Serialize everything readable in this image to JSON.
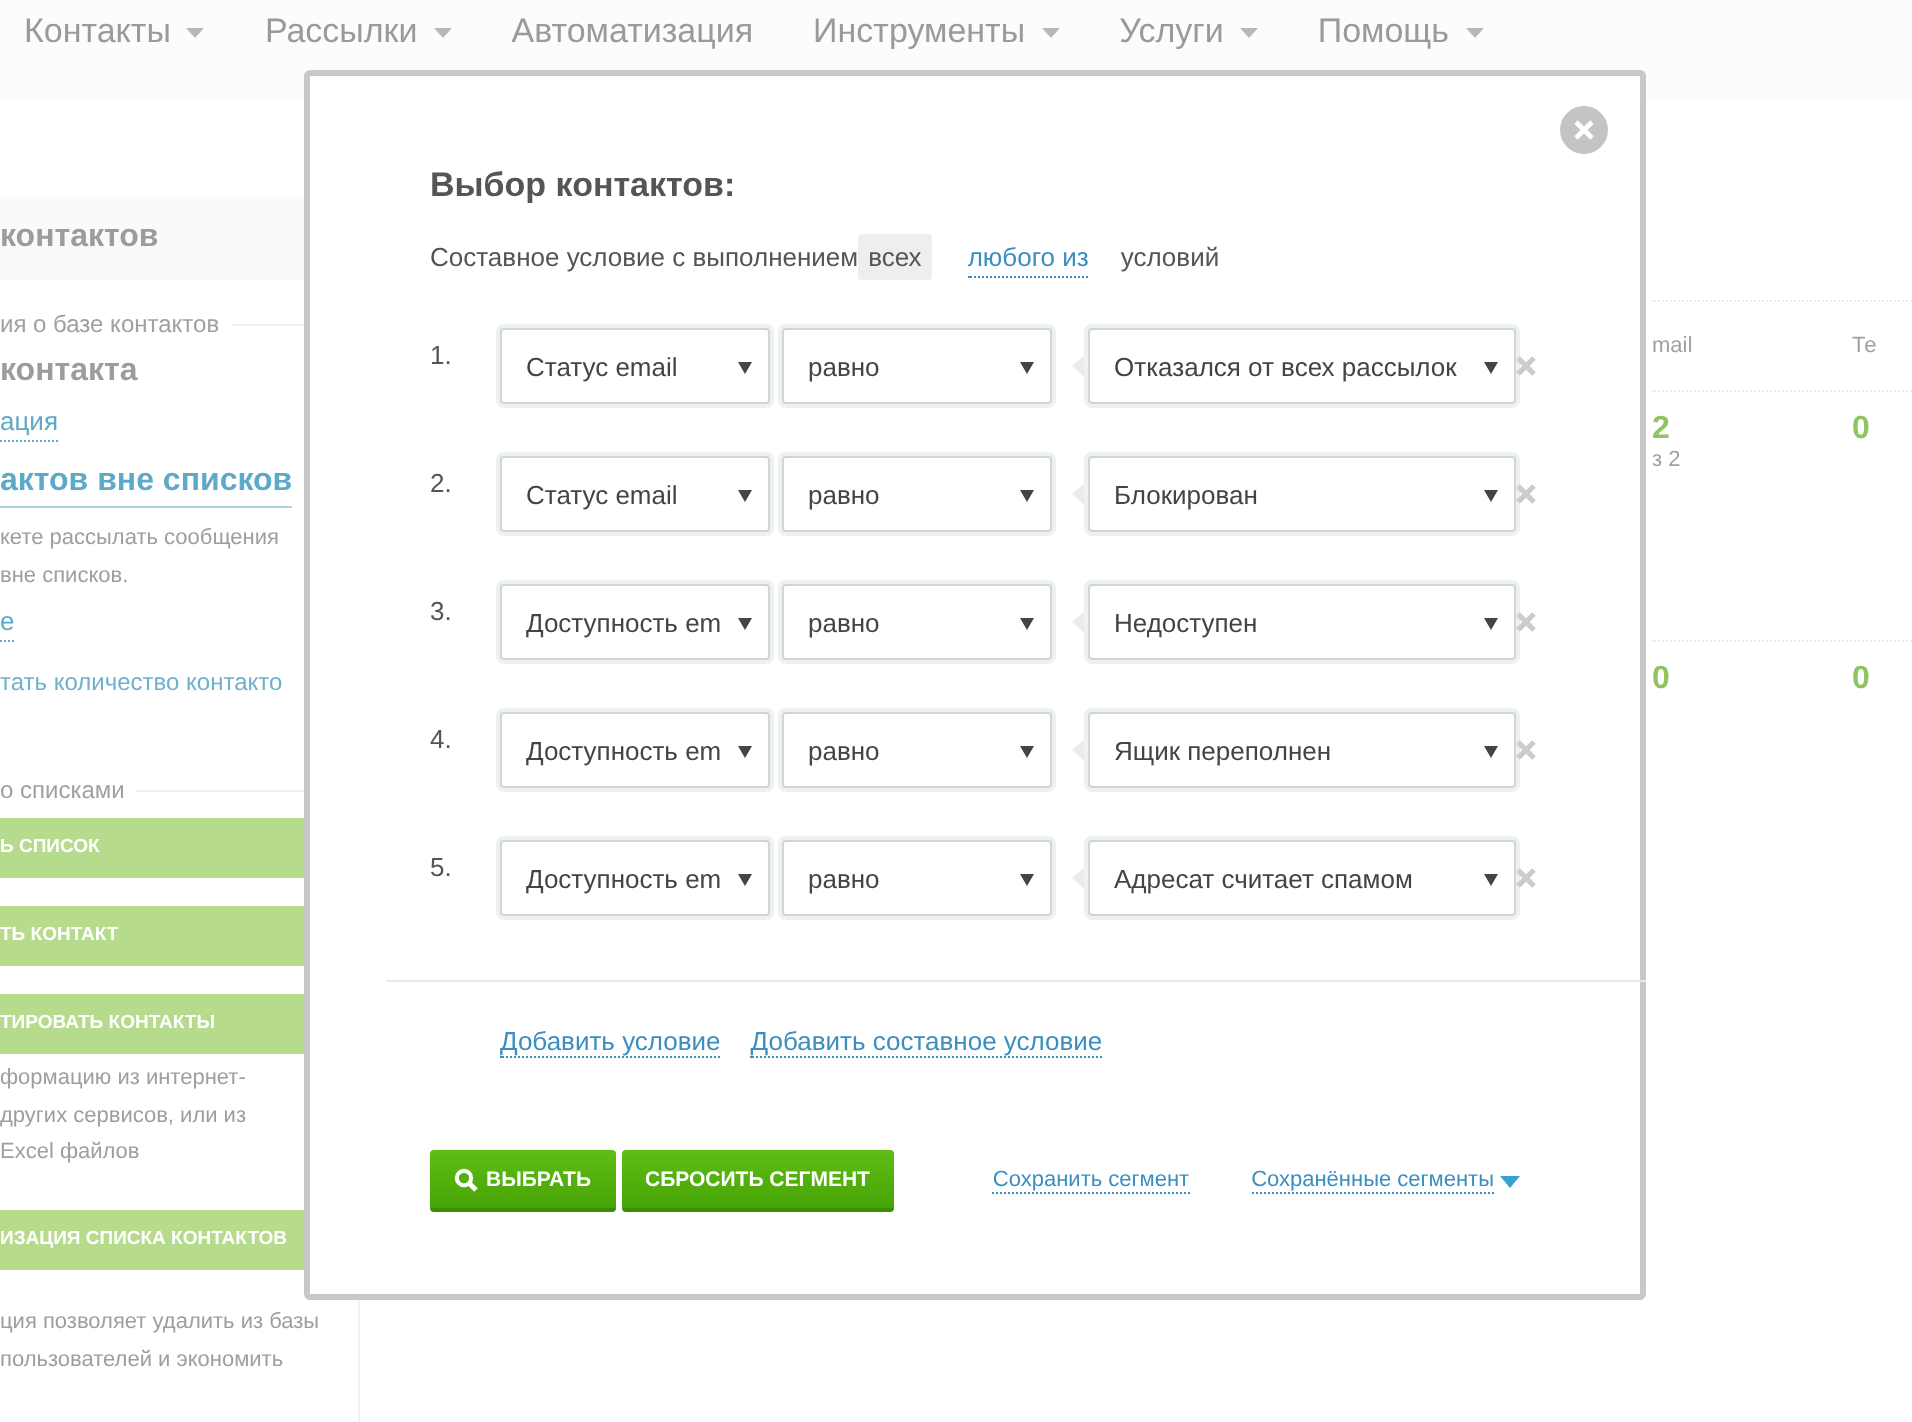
{
  "nav": [
    {
      "label": "Контакты",
      "dropdown": true
    },
    {
      "label": "Рассылки",
      "dropdown": true
    },
    {
      "label": "Автоматизация",
      "dropdown": false
    },
    {
      "label": "Инструменты",
      "dropdown": true
    },
    {
      "label": "Услуги",
      "dropdown": true
    },
    {
      "label": "Помощь",
      "dropdown": true
    }
  ],
  "sidebar": [
    {
      "kind": "heading",
      "text": "контактов"
    },
    {
      "kind": "section",
      "text": "ия о базе контактов"
    },
    {
      "kind": "title",
      "text": "контакта"
    },
    {
      "kind": "link",
      "text": "ация"
    },
    {
      "kind": "big-link",
      "text": "актов вне списков"
    },
    {
      "kind": "text",
      "text": "кете рассылать сообщения"
    },
    {
      "kind": "text",
      "text": "вне списков."
    },
    {
      "kind": "link",
      "text": "е"
    },
    {
      "kind": "faint-link",
      "text": "тать количество контакто"
    },
    {
      "kind": "section",
      "text": "о списками"
    },
    {
      "kind": "green",
      "text": "Ь СПИСОК"
    },
    {
      "kind": "green",
      "text": "ТЬ КОНТАКТ"
    },
    {
      "kind": "green",
      "text": "ТИРОВАТЬ КОНТАКТЫ"
    },
    {
      "kind": "text",
      "text": "формацию из интернет-"
    },
    {
      "kind": "text",
      "text": "других сервисов, или из"
    },
    {
      "kind": "text",
      "text": "Excel файлов"
    },
    {
      "kind": "green",
      "text": "ИЗАЦИЯ СПИСКА КОНТАКТОВ"
    },
    {
      "kind": "text",
      "text": "ция позволяет удалить из базы"
    },
    {
      "kind": "text",
      "text": "пользователей и экономить"
    }
  ],
  "table": {
    "columns": [
      "mail",
      "Те"
    ],
    "rows": [
      {
        "cells": [
          "2",
          "0"
        ],
        "note": "з 2"
      },
      {
        "cells": [
          "0",
          "0"
        ]
      }
    ]
  },
  "modal": {
    "title": "Выбор контактов:",
    "mode_label": "Составное условие с выполнением",
    "modes": [
      {
        "label": "всех",
        "selected": true
      },
      {
        "label": "любого из",
        "selected": false
      }
    ],
    "mode_suffix": "условий",
    "conditions": [
      {
        "number": "1.",
        "field": "Статус email",
        "operator": "равно",
        "value": "Отказался от всех рассылок"
      },
      {
        "number": "2.",
        "field": "Статус email",
        "operator": "равно",
        "value": "Блокирован"
      },
      {
        "number": "3.",
        "field": "Доступность em",
        "operator": "равно",
        "value": "Недоступен"
      },
      {
        "number": "4.",
        "field": "Доступность em",
        "operator": "равно",
        "value": "Ящик переполнен"
      },
      {
        "number": "5.",
        "field": "Доступность em",
        "operator": "равно",
        "value": "Адресат считает спамом"
      }
    ],
    "add_links": [
      "Добавить условие",
      "Добавить составное условие"
    ],
    "buttons": [
      "ВЫБРАТЬ",
      "СБРОСИТЬ СЕГМЕНТ"
    ],
    "segment_links": [
      {
        "label": "Сохранить сегмент",
        "dropdown": false
      },
      {
        "label": "Сохранённые сегменты",
        "dropdown": true
      }
    ]
  }
}
